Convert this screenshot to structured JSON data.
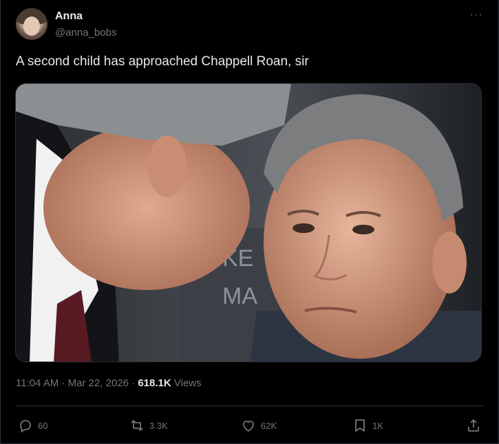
{
  "author": {
    "display_name": "Anna",
    "handle": "@anna_bobs"
  },
  "more_label": "···",
  "tweet": {
    "text": "A second child has approached Chappell Roan, sir",
    "media_sign_text": "KE\nMA"
  },
  "meta": {
    "time": "11:04 AM",
    "sep1": " · ",
    "date": "Mar 22, 2026",
    "sep2": " · ",
    "views_count": "618.1K",
    "views_label": " Views"
  },
  "actions": {
    "replies": "60",
    "reposts": "3.3K",
    "likes": "62K",
    "bookmarks": "1K"
  },
  "icons": {
    "reply": "reply-icon",
    "repost": "repost-icon",
    "like": "heart-icon",
    "bookmark": "bookmark-icon",
    "share": "share-icon",
    "more": "more-icon"
  }
}
